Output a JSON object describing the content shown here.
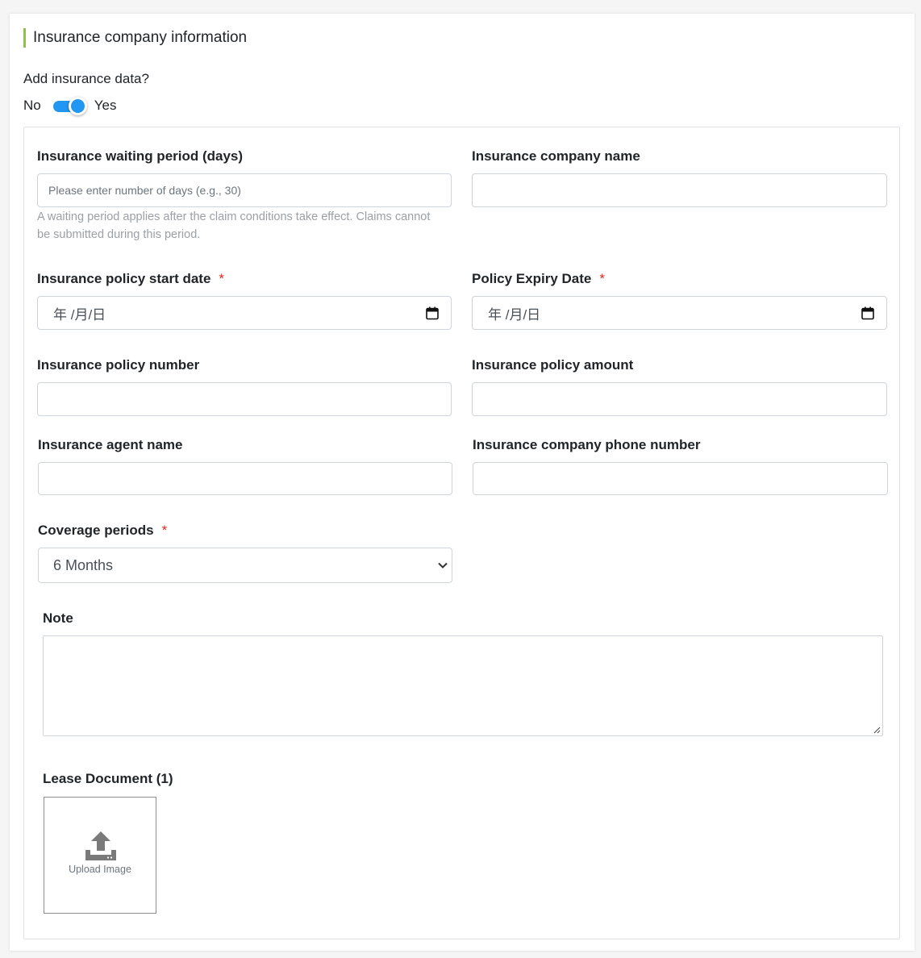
{
  "section": {
    "title": "Insurance company information"
  },
  "insurance_toggle": {
    "question": "Add insurance data?",
    "off_label": "No",
    "on_label": "Yes",
    "checked": true
  },
  "form": {
    "waiting_period": {
      "label": "Insurance waiting period (days)",
      "placeholder": "Please enter number of days (e.g., 30)",
      "help": "A waiting period applies after the claim conditions take effect. Claims cannot be submitted during this period."
    },
    "company_name": {
      "label": "Insurance company name",
      "value": ""
    },
    "start_date": {
      "label": "Insurance policy start date",
      "required_mark": "*",
      "display": "年 /月/日"
    },
    "expiry_date": {
      "label": "Policy Expiry Date",
      "required_mark": "*",
      "display": "年 /月/日"
    },
    "policy_number": {
      "label": "Insurance policy number",
      "value": ""
    },
    "policy_amount": {
      "label": "Insurance policy amount",
      "value": ""
    },
    "agent_name": {
      "label": "Insurance agent name",
      "value": ""
    },
    "company_phone": {
      "label": "Insurance company phone number",
      "value": ""
    },
    "coverage": {
      "label": "Coverage periods",
      "required_mark": "*",
      "selected": "6 Months"
    },
    "note": {
      "label": "Note",
      "value": ""
    },
    "lease_document": {
      "label": "Lease Document (1)",
      "upload_label": "Upload Image"
    }
  },
  "colors": {
    "accent_bar": "#8bc34a",
    "toggle_on": "#2196f3",
    "required": "#d9271a"
  }
}
